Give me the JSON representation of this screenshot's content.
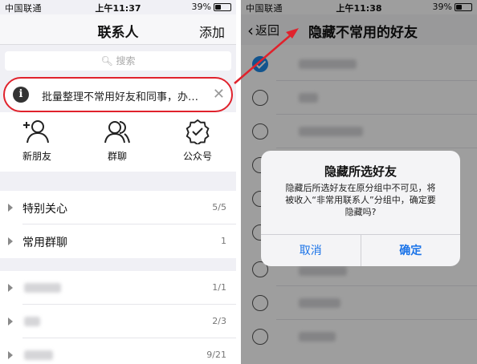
{
  "colors": {
    "accent": "#1a73e8",
    "highlight": "#e0222c",
    "check": "#1e88e5"
  },
  "left": {
    "status": {
      "carrier": "中国联通",
      "time": "上午11:37",
      "battery": "39%",
      "battery_level": 0.39
    },
    "nav": {
      "title": "联系人",
      "right": "添加"
    },
    "search": {
      "placeholder": "搜索"
    },
    "tip": {
      "text": "批量整理不常用好友和同事，办…",
      "close": "✕",
      "icon": "info-icon"
    },
    "quick": [
      {
        "label": "新朋友",
        "icon": "add-friend-icon"
      },
      {
        "label": "群聊",
        "icon": "group-chat-icon"
      },
      {
        "label": "公众号",
        "icon": "official-account-icon"
      }
    ],
    "groups": [
      {
        "name": "特别关心",
        "count": "5/5"
      },
      {
        "name": "常用群聊",
        "count": "1"
      },
      {
        "name": "",
        "count": "1/1"
      },
      {
        "name": "",
        "count": "2/3"
      },
      {
        "name": "",
        "count": "9/21"
      }
    ]
  },
  "right": {
    "status": {
      "carrier": "中国联通",
      "time": "上午11:38",
      "battery": "39%",
      "battery_level": 0.39
    },
    "nav": {
      "back": "返回",
      "title": "隐藏不常用的好友"
    },
    "dialog": {
      "title": "隐藏所选好友",
      "message_line1": "隐藏后所选好友在原分组中不可见，将",
      "message_line2": "被收入“非常用联系人”分组中，确定要",
      "message_line3": "隐藏吗?",
      "cancel": "取消",
      "confirm": "确定"
    }
  }
}
